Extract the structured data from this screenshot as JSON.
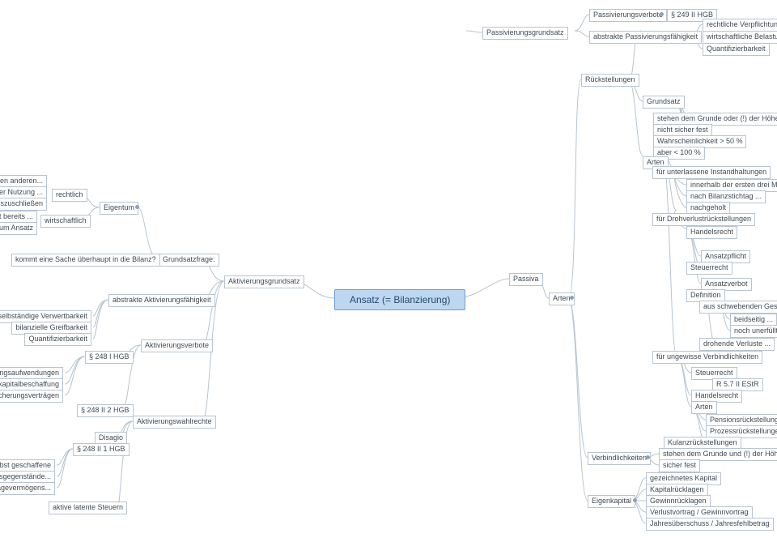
{
  "root": "Ansatz (= Bilanzierung)",
  "left": {
    "aktivierungsgrundsatz": "Aktivierungsgrundsatz",
    "abstrakte_aktiv": "abstrakte Aktivierungsfähigkeit",
    "grundsatzfrage": "Grundsatzfrage:",
    "kommt_sache": "kommt eine Sache überhaupt in die Bilanz?",
    "eigentum": "Eigentum",
    "rechtlich": "rechtlich",
    "wirtschaftlich": "wirtschaftlich",
    "das_recht": "das Recht, einen anderen...",
    "von_der_nutzung": "von der Nutzung ...",
    "auszuschliessen": "auszuschließen",
    "dies_reicht": "dies reicht bereits ...",
    "fuer_die_pflicht": "für die Pflicht zum Ansatz",
    "selbst_verwert": "selbständige Verwertbarkeit",
    "bilanz_greif": "bilanzielle Greifbarkeit",
    "quantifizier": "Quantifizierbarkeit",
    "aktiv_verbote": "Aktivierungsverbote",
    "p248I": "§ 248 I HGB",
    "gruendungs": "Gründungsaufwendungen",
    "aufwand_eigen": "Aufwand für Eigenkapitalbeschaffung",
    "aufwand_abschluss": "Aufwand für Abschluss von Versicherungsverträgen",
    "p248II2": "§ 248 II 2 HGB",
    "aktiv_wahl": "Aktivierungswahlrechte",
    "disagio": "Disagio",
    "p248II1": "§ 248 II 1 HGB",
    "selbst_geschaffene": "selbst geschaffene",
    "immateriell": "immaterielle Vermögensgegenstände...",
    "des_anlage": "des Anlagevermögens...",
    "aktive_latente": "aktive latente Steuern"
  },
  "right": {
    "passiva": "Passiva",
    "arten": "Arten",
    "ruecks": "Rückstellungen",
    "passivierungsgrundsatz": "Passivierungsgrundsatz",
    "passiv_verbote": "Passivierungsverbote",
    "p249II": "§ 249 II HGB",
    "abstrakte_passiv": "abstrakte Passivierungsfähigkeit",
    "rechtl_verpfl": "rechtliche Verpflichtung",
    "wirtsch_belast": "wirtschaftliche Belastung",
    "quantifizier2": "Quantifizierbarkeit",
    "grundsatz": "Grundsatz",
    "stehen_grunde": "stehen dem Grunde oder (!) der Höhe nach ...",
    "nicht_sicher": "nicht sicher fest",
    "wahrsch50": "Wahrscheinlichkeit > 50 %",
    "aber100": "aber < 100 %",
    "arten2": "Arten",
    "unterlassene": "für unterlassene Instandhaltungen",
    "innerhalb": "innerhalb der ersten drei Monate ...",
    "nach_bilanz": "nach Bilanzstichtag ...",
    "nachgeholt": "nachgeholt",
    "drohverlust": "für Drohverlustrückstellungen",
    "handelsrecht": "Handelsrecht",
    "ansatzpflicht": "Ansatzpflicht",
    "steuerrecht": "Steuerrecht",
    "ansatzverbot": "Ansatzverbot",
    "definition": "Definition",
    "aus_schwebenden": "aus schwebenden Geschäften",
    "beidseitig": "beidseitig ...",
    "noch_unerf": "noch unerfüllt",
    "drohende_verl": "drohende Verluste ...",
    "ungewisse": "für ungewisse Verbindlichkeiten",
    "steuerrecht2": "Steuerrecht",
    "r57": "R 5.7 II EStR",
    "handelsrecht2": "Handelsrecht",
    "arten3": "Arten",
    "pensions": "Pensionsrückstellungen",
    "prozess": "Prozessrückstellungen",
    "kulanz": "Kulanzrückstellungen",
    "verbindlichkeiten": "Verbindlichkeiten",
    "stehen_grunde2": "stehen dem Grunde und (!) der Höhe nach ...",
    "sicher_fest": "sicher fest",
    "eigenkapital": "Eigenkapital",
    "gezeichnetes": "gezeichnetes Kapital",
    "kapitalrueckl": "Kapitalrücklagen",
    "gewinnrueckl": "Gewinnrücklagen",
    "verlustvortrag": "Verlustvortrag / Gewinnvortrag",
    "jahresueber": "Jahresüberschuss / Jahresfehlbetrag"
  },
  "chart_data": {
    "type": "tree",
    "title": "Ansatz (= Bilanzierung)",
    "root": "Ansatz (= Bilanzierung)",
    "children": [
      {
        "name": "Aktivierungsgrundsatz",
        "children": [
          {
            "name": "Grundsatzfrage:",
            "children": [
              {
                "name": "kommt eine Sache überhaupt in die Bilanz?"
              },
              {
                "name": "Eigentum",
                "children": [
                  {
                    "name": "rechtlich",
                    "children": [
                      {
                        "name": "das Recht, einen anderen..."
                      },
                      {
                        "name": "von der Nutzung ..."
                      },
                      {
                        "name": "auszuschließen"
                      }
                    ]
                  },
                  {
                    "name": "wirtschaftlich",
                    "children": [
                      {
                        "name": "dies reicht bereits ..."
                      },
                      {
                        "name": "für die Pflicht zum Ansatz"
                      }
                    ]
                  }
                ]
              }
            ]
          },
          {
            "name": "abstrakte Aktivierungsfähigkeit",
            "children": [
              {
                "name": "selbständige Verwertbarkeit"
              },
              {
                "name": "bilanzielle Greifbarkeit"
              },
              {
                "name": "Quantifizierbarkeit"
              }
            ]
          },
          {
            "name": "Aktivierungsverbote",
            "children": [
              {
                "name": "§ 248 I HGB",
                "children": [
                  {
                    "name": "Gründungsaufwendungen"
                  },
                  {
                    "name": "Aufwand für Eigenkapitalbeschaffung"
                  },
                  {
                    "name": "Aufwand für Abschluss von Versicherungsverträgen"
                  }
                ]
              },
              {
                "name": "§ 248 II 2 HGB"
              }
            ]
          },
          {
            "name": "Aktivierungswahlrechte",
            "children": [
              {
                "name": "Disagio"
              },
              {
                "name": "§ 248 II 1 HGB",
                "children": [
                  {
                    "name": "selbst geschaffene"
                  },
                  {
                    "name": "immaterielle Vermögensgegenstände..."
                  },
                  {
                    "name": "des Anlagevermögens..."
                  }
                ]
              },
              {
                "name": "aktive latente Steuern"
              }
            ]
          }
        ]
      },
      {
        "name": "Passiva",
        "children": [
          {
            "name": "Arten",
            "children": [
              {
                "name": "Rückstellungen",
                "children": [
                  {
                    "name": "Passivierungsgrundsatz",
                    "children": [
                      {
                        "name": "Passivierungsverbote",
                        "children": [
                          {
                            "name": "§ 249 II HGB"
                          }
                        ]
                      },
                      {
                        "name": "abstrakte Passivierungsfähigkeit",
                        "children": [
                          {
                            "name": "rechtliche Verpflichtung"
                          },
                          {
                            "name": "wirtschaftliche Belastung"
                          },
                          {
                            "name": "Quantifizierbarkeit"
                          }
                        ]
                      }
                    ]
                  },
                  {
                    "name": "Grundsatz",
                    "children": [
                      {
                        "name": "stehen dem Grunde oder (!) der Höhe nach ..."
                      },
                      {
                        "name": "nicht sicher fest"
                      },
                      {
                        "name": "Wahrscheinlichkeit > 50 %"
                      },
                      {
                        "name": "aber < 100 %"
                      }
                    ]
                  },
                  {
                    "name": "Arten",
                    "children": [
                      {
                        "name": "für unterlassene Instandhaltungen",
                        "children": [
                          {
                            "name": "innerhalb der ersten drei Monate ..."
                          },
                          {
                            "name": "nach Bilanzstichtag ..."
                          },
                          {
                            "name": "nachgeholt"
                          }
                        ]
                      },
                      {
                        "name": "für Drohverlustrückstellungen",
                        "children": [
                          {
                            "name": "Handelsrecht",
                            "children": [
                              {
                                "name": "Ansatzpflicht"
                              }
                            ]
                          },
                          {
                            "name": "Steuerrecht",
                            "children": [
                              {
                                "name": "Ansatzverbot"
                              }
                            ]
                          },
                          {
                            "name": "Definition",
                            "children": [
                              {
                                "name": "aus schwebenden Geschäften",
                                "children": [
                                  {
                                    "name": "beidseitig ..."
                                  },
                                  {
                                    "name": "noch unerfüllt"
                                  }
                                ]
                              },
                              {
                                "name": "drohende Verluste ..."
                              }
                            ]
                          }
                        ]
                      },
                      {
                        "name": "für ungewisse Verbindlichkeiten",
                        "children": [
                          {
                            "name": "Steuerrecht",
                            "children": [
                              {
                                "name": "R 5.7 II EStR"
                              }
                            ]
                          },
                          {
                            "name": "Handelsrecht"
                          },
                          {
                            "name": "Arten",
                            "children": [
                              {
                                "name": "Pensionsrückstellungen"
                              },
                              {
                                "name": "Prozessrückstellungen"
                              },
                              {
                                "name": "Kulanzrückstellungen"
                              }
                            ]
                          }
                        ]
                      }
                    ]
                  }
                ]
              },
              {
                "name": "Verbindlichkeiten",
                "children": [
                  {
                    "name": "stehen dem Grunde und (!) der Höhe nach ..."
                  },
                  {
                    "name": "sicher fest"
                  }
                ]
              },
              {
                "name": "Eigenkapital",
                "children": [
                  {
                    "name": "gezeichnetes Kapital"
                  },
                  {
                    "name": "Kapitalrücklagen"
                  },
                  {
                    "name": "Gewinnrücklagen"
                  },
                  {
                    "name": "Verlustvortrag / Gewinnvortrag"
                  },
                  {
                    "name": "Jahresüberschuss / Jahresfehlbetrag"
                  }
                ]
              }
            ]
          }
        ]
      }
    ]
  }
}
